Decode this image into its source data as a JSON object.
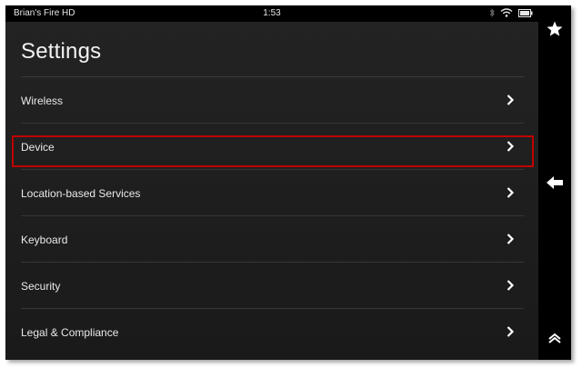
{
  "status_bar": {
    "device_name": "Brian's Fire HD",
    "time": "1:53",
    "icons": [
      "bluetooth-icon",
      "wifi-icon",
      "battery-icon"
    ]
  },
  "page": {
    "title": "Settings"
  },
  "settings": {
    "items": [
      {
        "label": "Wireless"
      },
      {
        "label": "Device",
        "highlighted": true
      },
      {
        "label": "Location-based Services"
      },
      {
        "label": "Keyboard"
      },
      {
        "label": "Security"
      },
      {
        "label": "Legal & Compliance"
      }
    ]
  },
  "sidebar": {
    "icons": [
      "star-icon",
      "back-arrow-icon",
      "scroll-up-icon"
    ]
  },
  "colors": {
    "background": "#1e1e1e",
    "text": "#e9e9e9",
    "highlight": "#c00000",
    "divider": "#363636"
  }
}
